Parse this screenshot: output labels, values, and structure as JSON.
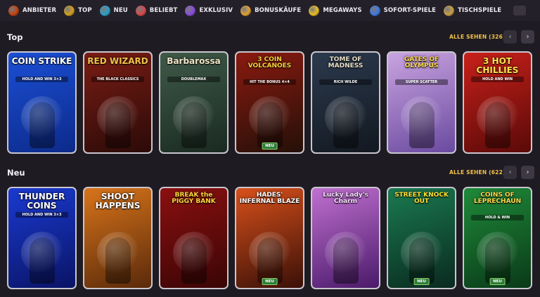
{
  "nav": {
    "items": [
      {
        "label": "ANBIETER",
        "icon": "provider-icon",
        "color": "#c2410c"
      },
      {
        "label": "TOP",
        "icon": "star-icon",
        "color": "#d4a017"
      },
      {
        "label": "NEU",
        "icon": "globe-icon",
        "color": "#2aa0c8"
      },
      {
        "label": "BELIEBT",
        "icon": "rocket-icon",
        "color": "#d94848"
      },
      {
        "label": "EXKLUSIV",
        "icon": "gem-icon",
        "color": "#8a4be0"
      },
      {
        "label": "BONUSKÄUFE",
        "icon": "bonus-bag-icon",
        "color": "#e0a030"
      },
      {
        "label": "MEGAWAYS",
        "icon": "megaways-icon",
        "color": "#e8c020"
      },
      {
        "label": "SOFORT-SPIELE",
        "icon": "instant-games-icon",
        "color": "#3a7ae0"
      },
      {
        "label": "TISCHSPIELE",
        "icon": "table-games-icon",
        "color": "#c8a040"
      }
    ]
  },
  "sections": {
    "top": {
      "title": "Top",
      "see_all": "ALLE SEHEN (326)"
    },
    "neu": {
      "title": "Neu",
      "see_all": "ALLE SEHEN (622)"
    }
  },
  "arrows": {
    "prev": "‹",
    "next": "›"
  },
  "top_games": [
    {
      "title": "COIN STRIKE",
      "sub": "HOLD AND WIN 3×3",
      "bg": "#1b4fd6",
      "bg2": "#0c2a8a",
      "tcolor": "#ffffff",
      "badge": ""
    },
    {
      "title": "RED WIZARD",
      "sub": "THE BLACK CLASSICS",
      "bg": "#7a1d14",
      "bg2": "#2b0a08",
      "tcolor": "#f2c14a",
      "badge": ""
    },
    {
      "title": "Barbarossa",
      "sub": "DOUBLEMAX",
      "bg": "#3f5a48",
      "bg2": "#1a2a22",
      "tcolor": "#f0e6c8",
      "badge": ""
    },
    {
      "title": "3 COIN VOLCANOES",
      "sub": "HIT THE BONUS 4×4",
      "bg": "#8a1a10",
      "bg2": "#241008",
      "tcolor": "#f7d23a",
      "badge": "NEU"
    },
    {
      "title": "TOME OF MADNESS",
      "sub": "RICH WILDE",
      "bg": "#2c3a4e",
      "bg2": "#121820",
      "tcolor": "#e8e0c8",
      "badge": ""
    },
    {
      "title": "GATES OF OLYMPUS",
      "sub": "SUPER SCATTER",
      "bg": "#c9a4e0",
      "bg2": "#6a4aa0",
      "tcolor": "#ffd84a",
      "badge": ""
    },
    {
      "title": "3 HOT CHILLIES",
      "sub": "HOLD AND WIN",
      "bg": "#c8201a",
      "bg2": "#5a0a08",
      "tcolor": "#ffe14a",
      "badge": ""
    }
  ],
  "neu_games": [
    {
      "title": "THUNDER COINS",
      "sub": "HOLD AND WIN 3×3",
      "bg": "#1a3ad0",
      "bg2": "#0a1466",
      "tcolor": "#ffffff",
      "badge": ""
    },
    {
      "title": "SHOOT HAPPENS",
      "sub": "",
      "bg": "#d8741a",
      "bg2": "#5a2a0a",
      "tcolor": "#ffffff",
      "badge": ""
    },
    {
      "title": "BREAK the PIGGY BANK",
      "sub": "",
      "bg": "#8a1010",
      "bg2": "#3a0505",
      "tcolor": "#ffd73a",
      "badge": ""
    },
    {
      "title": "HADES' INFERNAL BLAZE",
      "sub": "",
      "bg": "#d8501a",
      "bg2": "#3a1008",
      "tcolor": "#ffffff",
      "badge": "NEU"
    },
    {
      "title": "Lucky Lady's Charm",
      "sub": "",
      "bg": "#c070d0",
      "bg2": "#4a1a6a",
      "tcolor": "#f8e0ff",
      "badge": ""
    },
    {
      "title": "STREET KNOCK OUT",
      "sub": "",
      "bg": "#1a7a50",
      "bg2": "#0a2a20",
      "tcolor": "#ffe030",
      "badge": "NEU"
    },
    {
      "title": "COINS OF LEPRECHAUN",
      "sub": "HOLD & WIN",
      "bg": "#1f8a3a",
      "bg2": "#0a3a18",
      "tcolor": "#ffd84a",
      "badge": "NEU"
    }
  ]
}
